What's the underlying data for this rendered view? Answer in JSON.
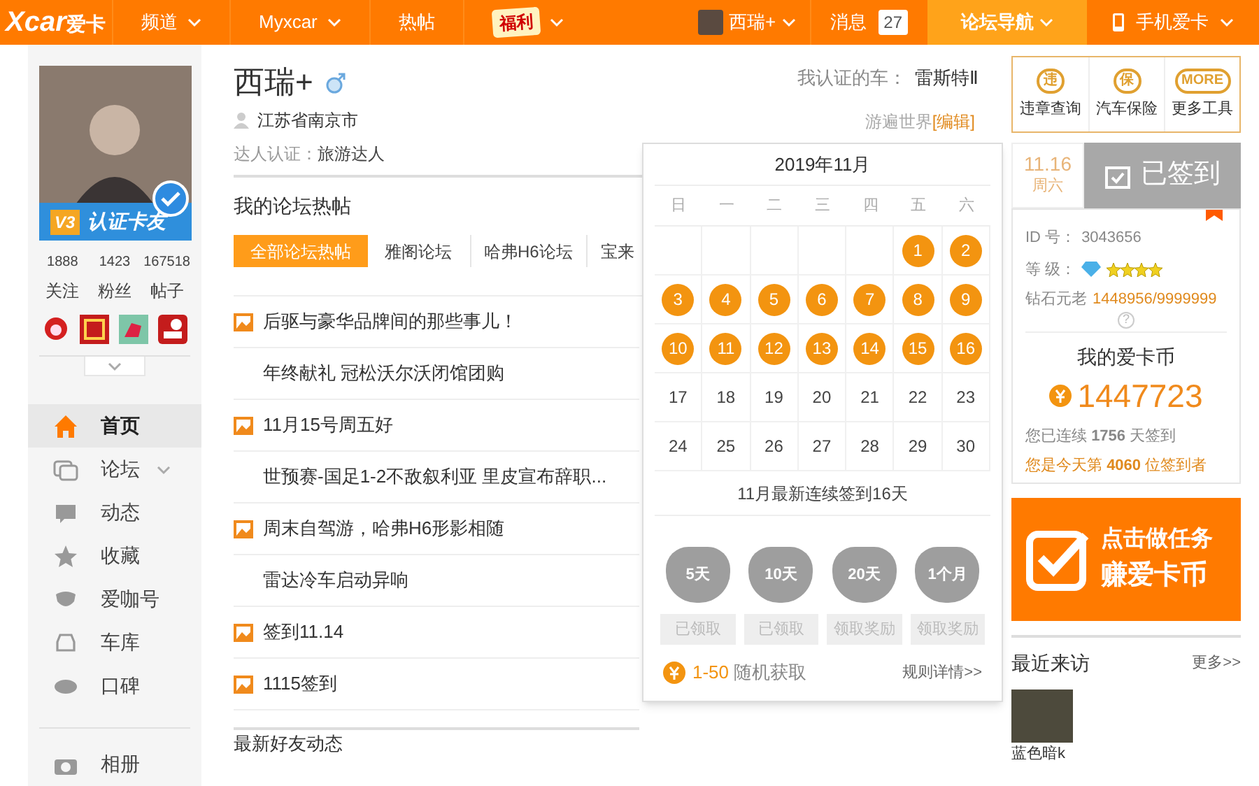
{
  "topbar": {
    "logo": "Xcar",
    "logo_cn": "爱卡",
    "items": [
      {
        "label": "频道",
        "caret": true,
        "kind": "text"
      },
      {
        "label": "Myxcar",
        "caret": true,
        "kind": "text"
      },
      {
        "label": "热帖",
        "caret": false,
        "kind": "text"
      },
      {
        "label": "福利",
        "caret": true,
        "kind": "badge"
      }
    ],
    "user": "西瑞+",
    "messages": {
      "label": "消息",
      "count": "27"
    },
    "forum_nav": {
      "label": "论坛导航",
      "selected": true
    },
    "mobile": "手机爱卡"
  },
  "profile": {
    "verified_level": "V3",
    "verified_label": "认证卡友",
    "stats": [
      {
        "value": "1888",
        "label": "关注"
      },
      {
        "value": "1423",
        "label": "粉丝"
      },
      {
        "value": "167518",
        "label": "帖子"
      }
    ]
  },
  "sidebar": {
    "items": [
      {
        "label": "首页",
        "selected": true,
        "has_menu": false
      },
      {
        "label": "论坛",
        "selected": false,
        "has_menu": true
      },
      {
        "label": "动态",
        "selected": false,
        "has_menu": false
      },
      {
        "label": "收藏",
        "selected": false,
        "has_menu": false
      },
      {
        "label": "爱咖号",
        "selected": false,
        "has_menu": false
      },
      {
        "label": "车库",
        "selected": false,
        "has_menu": false
      },
      {
        "label": "口碑",
        "selected": false,
        "has_menu": false
      }
    ],
    "extra": [
      {
        "label": "相册"
      }
    ]
  },
  "user": {
    "name": "西瑞+",
    "location": "江苏省南京市",
    "expert_label": "达人认证：",
    "expert": "旅游达人",
    "car_label": "我认证的车：",
    "car": "雷斯特Ⅱ",
    "motto": "游遍世界",
    "edit": "[编辑]"
  },
  "forum": {
    "title": "我的论坛热帖",
    "tabs": [
      {
        "label": "全部论坛热帖",
        "selected": true
      },
      {
        "label": "雅阁论坛",
        "selected": false
      },
      {
        "label": "哈弗H6论坛",
        "selected": false
      },
      {
        "label": "宝来",
        "selected": false
      }
    ],
    "posts": [
      {
        "title": "后驱与豪华品牌间的那些事儿！",
        "has_image": true
      },
      {
        "title": "年终献礼 冠松沃尔沃闭馆团购",
        "has_image": false
      },
      {
        "title": "11月15号周五好",
        "has_image": true
      },
      {
        "title": "世预赛-国足1-2不敌叙利亚 里皮宣布辞职...",
        "has_image": false
      },
      {
        "title": "周末自驾游，哈弗H6形影相随",
        "has_image": true
      },
      {
        "title": "雷达冷车启动异响",
        "has_image": false
      },
      {
        "title": "签到11.14",
        "has_image": true
      },
      {
        "title": "1115签到",
        "has_image": true
      }
    ]
  },
  "friends_title": "最新好友动态",
  "calendar": {
    "title": "2019年11月",
    "weekdays": [
      "日",
      "一",
      "二",
      "三",
      "四",
      "五",
      "六"
    ],
    "days": [
      {
        "kind": "blank"
      },
      {
        "kind": "blank"
      },
      {
        "kind": "blank"
      },
      {
        "kind": "blank"
      },
      {
        "kind": "blank"
      },
      {
        "kind": "day",
        "label": "1",
        "signed": true
      },
      {
        "kind": "day",
        "label": "2",
        "signed": true
      },
      {
        "kind": "day",
        "label": "3",
        "signed": true
      },
      {
        "kind": "day",
        "label": "4",
        "signed": true
      },
      {
        "kind": "day",
        "label": "5",
        "signed": true
      },
      {
        "kind": "day",
        "label": "6",
        "signed": true
      },
      {
        "kind": "day",
        "label": "7",
        "signed": true
      },
      {
        "kind": "day",
        "label": "8",
        "signed": true
      },
      {
        "kind": "day",
        "label": "9",
        "signed": true
      },
      {
        "kind": "day",
        "label": "10",
        "signed": true
      },
      {
        "kind": "day",
        "label": "11",
        "signed": true
      },
      {
        "kind": "day",
        "label": "12",
        "signed": true
      },
      {
        "kind": "day",
        "label": "13",
        "signed": true
      },
      {
        "kind": "day",
        "label": "14",
        "signed": true
      },
      {
        "kind": "day",
        "label": "15",
        "signed": true
      },
      {
        "kind": "day",
        "label": "16",
        "signed": true
      },
      {
        "kind": "day",
        "label": "17",
        "signed": false
      },
      {
        "kind": "day",
        "label": "18",
        "signed": false
      },
      {
        "kind": "day",
        "label": "19",
        "signed": false
      },
      {
        "kind": "day",
        "label": "20",
        "signed": false
      },
      {
        "kind": "day",
        "label": "21",
        "signed": false
      },
      {
        "kind": "day",
        "label": "22",
        "signed": false
      },
      {
        "kind": "day",
        "label": "23",
        "signed": false
      },
      {
        "kind": "day",
        "label": "24",
        "signed": false
      },
      {
        "kind": "day",
        "label": "25",
        "signed": false
      },
      {
        "kind": "day",
        "label": "26",
        "signed": false
      },
      {
        "kind": "day",
        "label": "27",
        "signed": false
      },
      {
        "kind": "day",
        "label": "28",
        "signed": false
      },
      {
        "kind": "day",
        "label": "29",
        "signed": false
      },
      {
        "kind": "day",
        "label": "30",
        "signed": false
      }
    ],
    "streak": "11月最新连续签到16天",
    "rewards": [
      {
        "bag": "5天",
        "button": "已领取"
      },
      {
        "bag": "10天",
        "button": "已领取"
      },
      {
        "bag": "20天",
        "button": "领取奖励"
      },
      {
        "bag": "1个月",
        "button": "领取奖励"
      }
    ],
    "range": "1-50",
    "range_text": "随机获取",
    "rules": "规则详情>>"
  },
  "tools": [
    {
      "label": "违章查询",
      "glyph": "违"
    },
    {
      "label": "汽车保险",
      "glyph": "保"
    },
    {
      "label": "更多工具",
      "glyph": "MORE"
    }
  ],
  "signin": {
    "date": "11.16",
    "weekday": "周六",
    "button": "已签到",
    "signed": true
  },
  "account": {
    "id_label": "ID 号：",
    "id": "3043656",
    "level_label": "等 级：",
    "stars": 4,
    "rank": "钻石元老",
    "points": "1448956/9999999",
    "help": "?",
    "coins_title": "我的爱卡币",
    "coins": "1447723",
    "streak": "您已连续 **1756** 天签到",
    "rank_today": "您是今天第 **4060** 位签到者"
  },
  "task_banner": {
    "line1": "点击做任务",
    "line2": "赚爱卡币"
  },
  "visitors": {
    "title": "最近来访",
    "more": "更多>>",
    "items": [
      {
        "name": "蓝色暗k"
      }
    ]
  }
}
